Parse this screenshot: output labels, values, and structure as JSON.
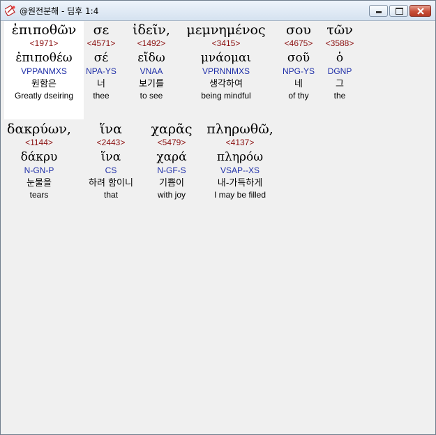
{
  "window": {
    "title": "@원전분해 - 딤후 1:4",
    "controls": {
      "minimize": "minimize-icon",
      "maximize": "maximize-icon",
      "close": "close-icon"
    }
  },
  "words": [
    {
      "greek": "ἐπιποθῶν",
      "strong": "<1971>",
      "lemma": "ἐπιποθέω",
      "morph": "VPPANMXS",
      "korean": "원함은",
      "english": "Greatly dseiring",
      "selected": true
    },
    {
      "greek": "σε",
      "strong": "<4571>",
      "lemma": "σέ",
      "morph": "NPA-YS",
      "korean": "너",
      "english": "thee"
    },
    {
      "greek": "ἰδεῖν,",
      "strong": "<1492>",
      "lemma": "εἴδω",
      "morph": "VNAA",
      "korean": "보기를",
      "english": "to see"
    },
    {
      "greek": "μεμνημένος",
      "strong": "<3415>",
      "lemma": "μνάομαι",
      "morph": "VPRNNMXS",
      "korean": "생각하여",
      "english": "being mindful"
    },
    {
      "greek": "σου",
      "strong": "<4675>",
      "lemma": "σοῦ",
      "morph": "NPG-YS",
      "korean": "네",
      "english": "of thy"
    },
    {
      "greek": "τῶν",
      "strong": "<3588>",
      "lemma": "ὁ",
      "morph": "DGNP",
      "korean": "그",
      "english": "the"
    },
    {
      "greek": "δακρύων,",
      "strong": "<1144>",
      "lemma": "δάκρυ",
      "morph": "N-GN-P",
      "korean": "눈물을",
      "english": "tears"
    },
    {
      "greek": "ἵνα",
      "strong": "<2443>",
      "lemma": "ἵνα",
      "morph": "CS",
      "korean": "하려 함이니",
      "english": "that"
    },
    {
      "greek": "χαρᾶς",
      "strong": "<5479>",
      "lemma": "χαρά",
      "morph": "N-GF-S",
      "korean": "기쁨이",
      "english": "with joy"
    },
    {
      "greek": "πληρωθῶ,",
      "strong": "<4137>",
      "lemma": "πληρόω",
      "morph": "VSAP--XS",
      "korean": "내-가득하게",
      "english": "I may be filled"
    }
  ]
}
